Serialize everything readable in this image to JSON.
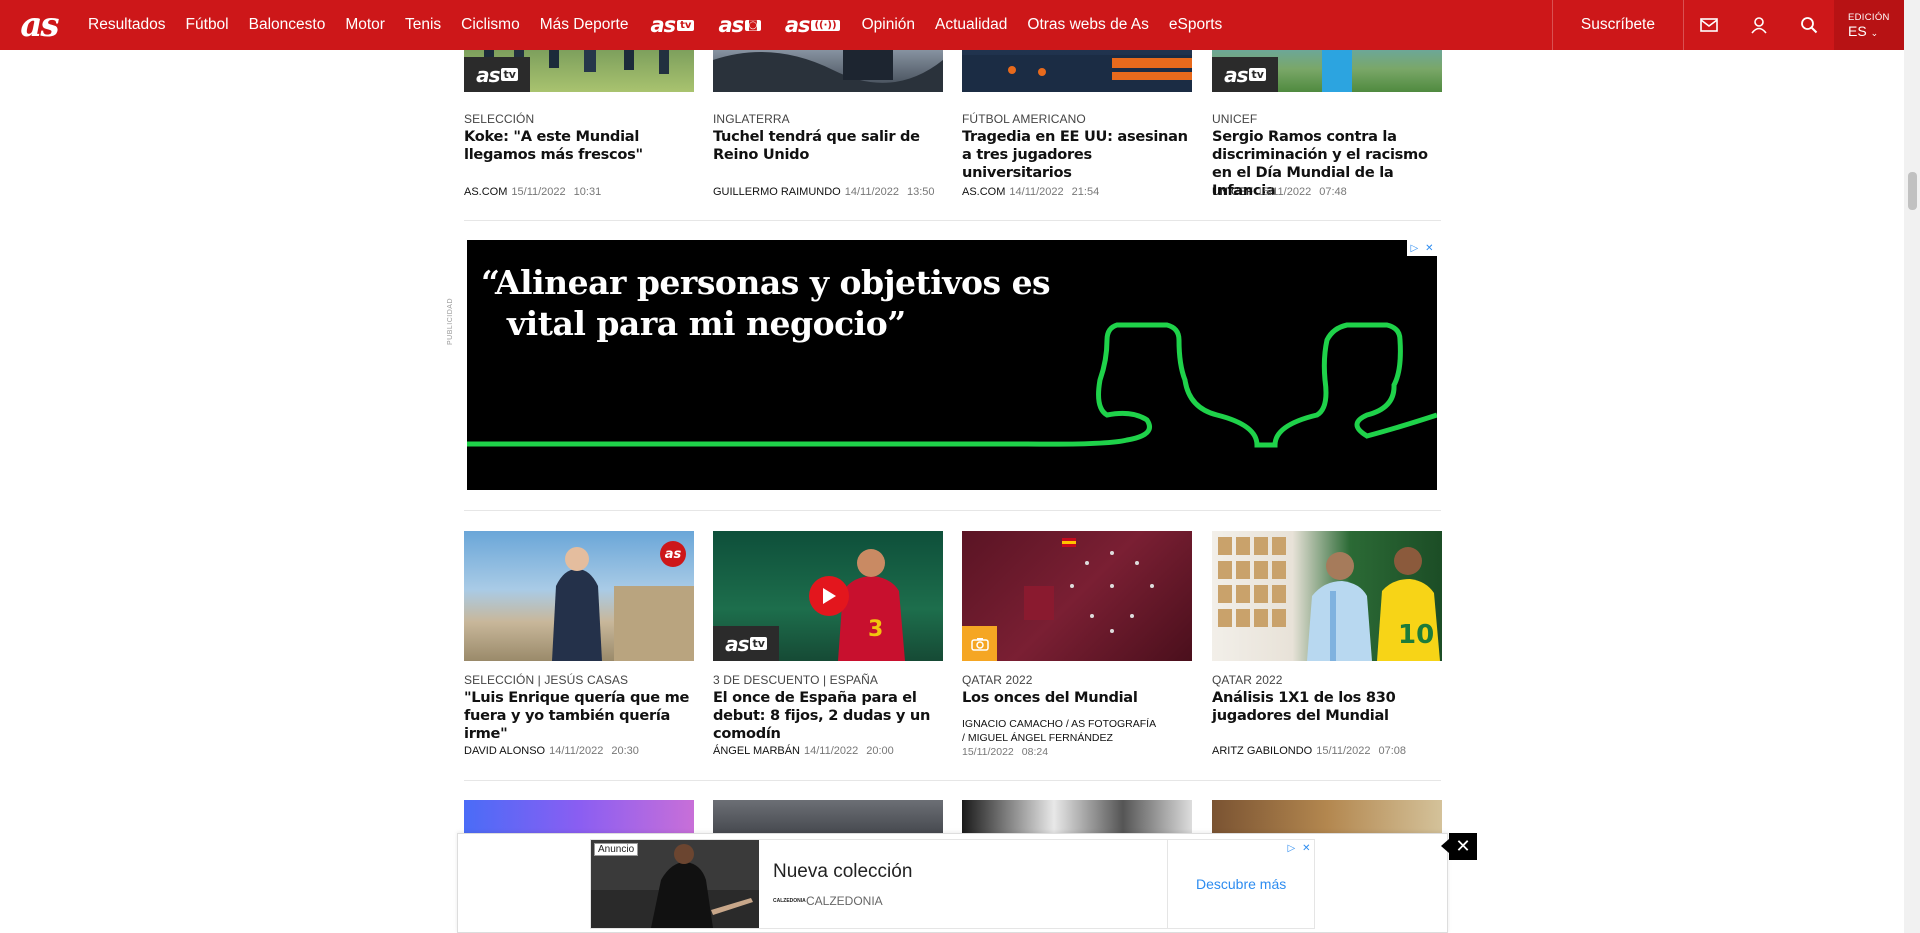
{
  "header": {
    "logo": "as",
    "nav": [
      "Resultados",
      "Fútbol",
      "Baloncesto",
      "Motor",
      "Tenis",
      "Ciclismo",
      "Más Deporte"
    ],
    "brands": [
      {
        "name": "as",
        "tag": "tv"
      },
      {
        "name": "as",
        "tag": "◙"
      },
      {
        "name": "as",
        "tag": "((·))"
      }
    ],
    "nav2": [
      "Opinión",
      "Actualidad",
      "Otras webs de As",
      "eSports"
    ],
    "subscribe": "Suscríbete",
    "edition_label": "EDICIÓN",
    "edition_value": "ES",
    "icons": [
      "mail-icon",
      "user-icon",
      "search-icon"
    ]
  },
  "row1": [
    {
      "kicker": "SELECCIÓN",
      "headline": "Koke: \"A este Mundial llegamos más frescos\"",
      "author": "AS.COM",
      "date": "15/11/2022",
      "time": "10:31",
      "badge": "astv"
    },
    {
      "kicker": "INGLATERRA",
      "headline": "Tuchel tendrá que salir de Reino Unido",
      "author": "GUILLERMO RAIMUNDO",
      "date": "14/11/2022",
      "time": "13:50",
      "badge": ""
    },
    {
      "kicker": "FÚTBOL AMERICANO",
      "headline": "Tragedia en EE UU: asesinan a tres jugadores universitarios",
      "author": "AS.COM",
      "date": "14/11/2022",
      "time": "21:54",
      "badge": ""
    },
    {
      "kicker": "UNICEF",
      "headline": "Sergio Ramos contra la discriminación y el racismo en el Día Mundial de la Infancia",
      "author": "UNICEF",
      "date": "15/11/2022",
      "time": "07:48",
      "badge": "astv"
    }
  ],
  "ad": {
    "label": "PUBLICIDAD",
    "quote_line1": "“Alinear personas y objetivos es",
    "quote_line2": "vital para mi negocio”"
  },
  "row2": [
    {
      "kicker": "SELECCIÓN | JESÚS CASAS",
      "headline": "\"Luis Enrique quería que me fuera y yo también quería irme\"",
      "author": "DAVID ALONSO",
      "date": "14/11/2022",
      "time": "20:30"
    },
    {
      "kicker": "3 DE DESCUENTO | ESPAÑA",
      "headline": "El once de España para el debut: 8 fijos, 2 dudas y un comodín",
      "author": "ÁNGEL MARBÁN",
      "date": "14/11/2022",
      "time": "20:00"
    },
    {
      "kicker": "QATAR 2022",
      "headline": "Los onces del Mundial",
      "author_lines": [
        "IGNACIO CAMACHO  /  AS FOTOGRAFÍA",
        "/  MIGUEL ÁNGEL FERNÁNDEZ"
      ],
      "date": "15/11/2022",
      "time": "08:24"
    },
    {
      "kicker": "QATAR 2022",
      "headline": "Análisis 1X1 de los 830 jugadores del Mundial",
      "author": "ARITZ GABILONDO",
      "date": "15/11/2022",
      "time": "07:08"
    }
  ],
  "sticky_ad": {
    "anuncio": "Anuncio",
    "title": "Nueva colección",
    "brand_logo": "CALZEDONIA",
    "brand": "CALZEDONIA",
    "cta": "Descubre más"
  },
  "colors": {
    "brand_red": "#cd1719",
    "ad_green": "#1fd24a",
    "link_blue": "#2d8cf0"
  }
}
